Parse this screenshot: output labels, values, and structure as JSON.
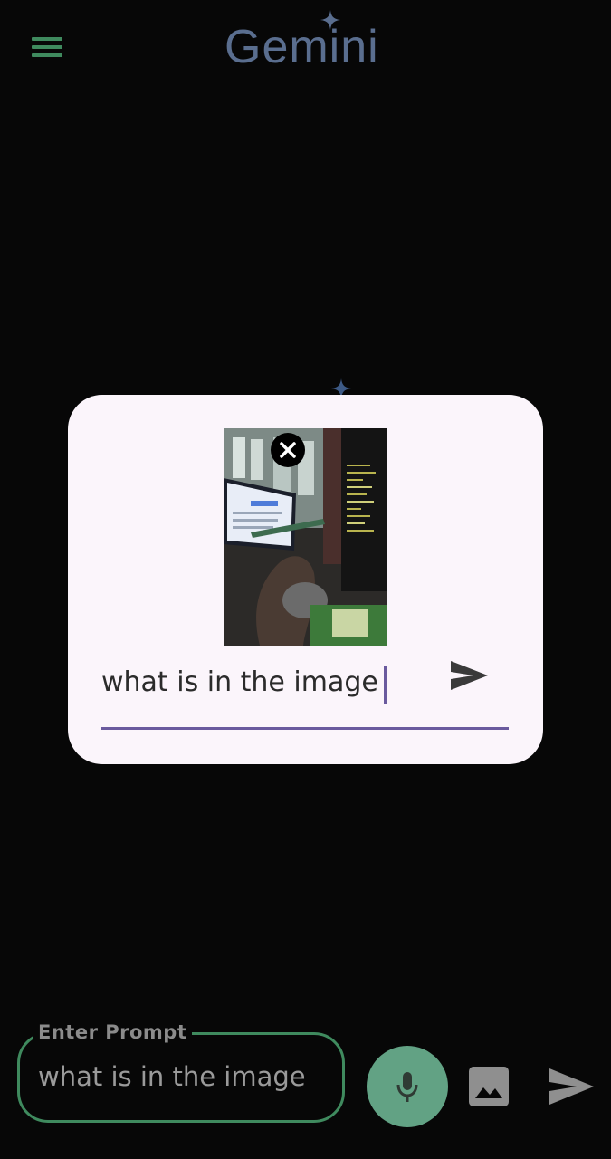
{
  "header": {
    "menu_icon": "hamburger-menu-icon",
    "app_title": "Gemini",
    "logo_star_color": "#5a6e8f",
    "accent_color": "#3f8a5e"
  },
  "dialog": {
    "image_preview_icon": "attached-image-preview",
    "remove_icon": "close-circle-icon",
    "input_value": "what is in the image",
    "send_icon": "send-icon",
    "underline_color": "#6a5a9e"
  },
  "prompt_bar": {
    "label": "Enter Prompt",
    "value": "what is in the image",
    "mic_icon": "microphone-icon",
    "mic_color": "#62a284",
    "image_icon": "image-icon",
    "send_icon": "send-icon"
  }
}
